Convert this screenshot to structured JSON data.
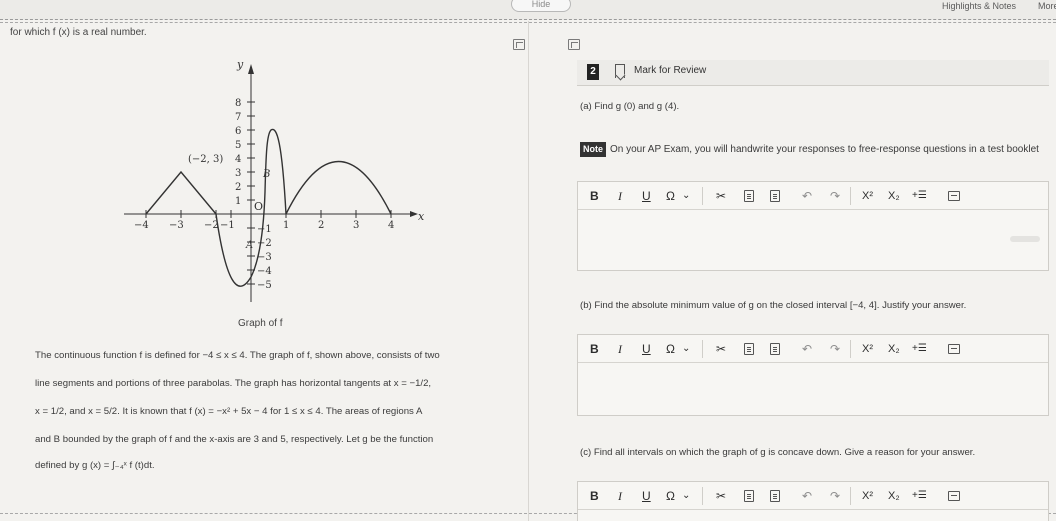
{
  "topbar": {
    "hide_label": "Hide",
    "highlights_label": "Highlights & Notes",
    "more_label": "More"
  },
  "stem": {
    "intro": "for which f (x) is a real number.",
    "graph_caption": "Graph of f",
    "line1": "The continuous function f is defined for −4 ≤ x ≤ 4. The graph of f, shown above, consists of two",
    "line2": "line segments and portions of three parabolas. The graph has horizontal tangents at x = −1/2,",
    "line3": "x = 1/2, and x = 5/2. It is known that f (x) = −x² + 5x − 4 for 1 ≤ x ≤ 4. The areas of regions A",
    "line4": "and B bounded by the graph of f and the x-axis are 3 and 5, respectively. Let g be the function",
    "line5": "defined by g (x) = ∫₋₄ˣ f (t)dt."
  },
  "graph": {
    "y_axis_label": "y",
    "x_axis_label": "x",
    "y_ticks": [
      "8",
      "7",
      "6",
      "5",
      "4",
      "3",
      "2",
      "1",
      "−1",
      "−2",
      "−3",
      "−4",
      "−5"
    ],
    "x_ticks": [
      "−4",
      "−3",
      "−2",
      "−1",
      "1",
      "2",
      "3",
      "4"
    ],
    "origin_label": "O",
    "point_label": "(−2, 3)",
    "region_a": "A",
    "region_b": "B"
  },
  "question": {
    "number": "2",
    "mark_for_review": "Mark for Review",
    "part_a": "(a) Find g (0) and g (4).",
    "note_badge": "Note",
    "note_text": "On your AP Exam, you will handwrite your responses to free-response questions in a test booklet",
    "part_b": "(b) Find the absolute minimum value of g on the closed interval [−4, 4]. Justify your answer.",
    "part_c": "(c) Find all intervals on which the graph of g is concave down. Give a reason for your answer."
  },
  "toolbar": {
    "bold": "B",
    "italic": "I",
    "underline": "U",
    "omega": "Ω",
    "chevron": "⌄",
    "cut": "✂",
    "undo": "↶",
    "redo": "↷",
    "superscript": "X²",
    "subscript": "X₂",
    "insert_equation": "+☰"
  },
  "colors": {
    "background": "#f3f2ef",
    "question_number_bg": "#222222",
    "editor_bg": "#f7f6f3"
  }
}
